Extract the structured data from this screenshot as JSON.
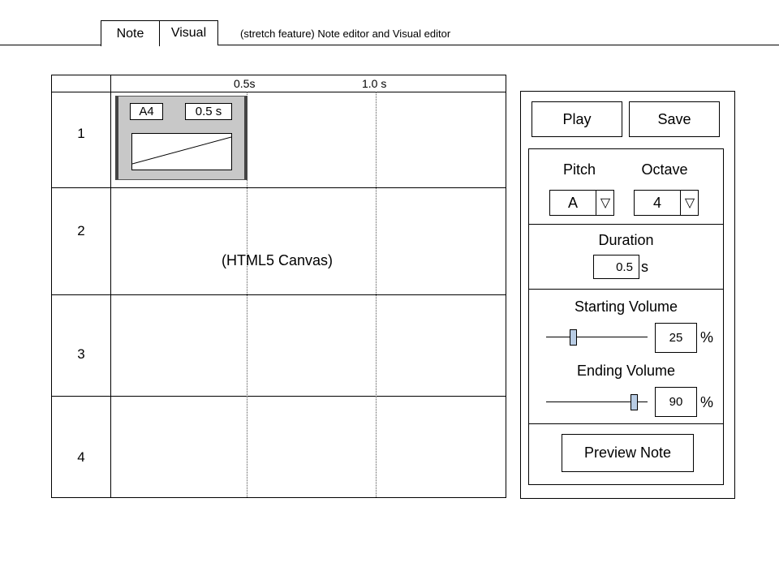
{
  "tabs": [
    {
      "label": "Note",
      "active": true
    },
    {
      "label": "Visual",
      "active": false
    }
  ],
  "tab_description": "(stretch feature) Note editor and Visual editor",
  "timeline": {
    "time_labels": [
      "0.5s",
      "1.0 s"
    ],
    "rows": [
      "1",
      "2",
      "3",
      "4"
    ],
    "canvas_label": "(HTML5 Canvas)"
  },
  "note_block": {
    "pitch_label": "A4",
    "duration_label": "0.5 s"
  },
  "panel": {
    "play_label": "Play",
    "save_label": "Save",
    "pitch": {
      "label": "Pitch",
      "value": "A",
      "arrow": "▽"
    },
    "octave": {
      "label": "Octave",
      "value": "4",
      "arrow": "▽"
    },
    "duration": {
      "label": "Duration",
      "value": "0.5",
      "unit": "s"
    },
    "starting_volume": {
      "label": "Starting Volume",
      "value": "25",
      "unit": "%"
    },
    "ending_volume": {
      "label": "Ending Volume",
      "value": "90",
      "unit": "%"
    },
    "preview_label": "Preview Note"
  },
  "colors": {
    "note_fill": "#c8c8c8",
    "slider_thumb": "#b8cce4"
  }
}
